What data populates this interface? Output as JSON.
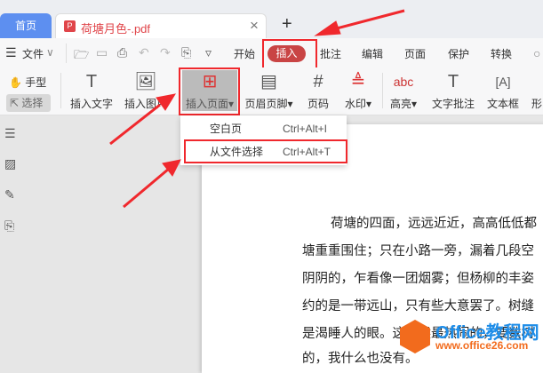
{
  "tabs": {
    "home": "首页",
    "document": "荷塘月色-.pdf",
    "pdf_icon": "P",
    "close": "×",
    "new_tab": "+"
  },
  "menu": {
    "hamburger": "☰",
    "file": "文件",
    "file_chevron": "∨",
    "more": "▿",
    "items": [
      "开始",
      "插入",
      "批注",
      "编辑",
      "页面",
      "保护",
      "转换"
    ]
  },
  "ribbon": {
    "hand": "手型",
    "select": "选择",
    "buttons": [
      "插入文字",
      "插入图片",
      "插入页面",
      "页眉页脚",
      "页码",
      "水印",
      "高亮",
      "文字批注",
      "文本框",
      "形"
    ]
  },
  "dropdown": {
    "items": [
      {
        "label": "空白页",
        "shortcut": "Ctrl+Alt+I"
      },
      {
        "label": "从文件选择",
        "shortcut": "Ctrl+Alt+T"
      }
    ]
  },
  "document": {
    "lines": [
      "荷塘的四面，远远近近，高高低低都",
      "塘重重围住；只在小路一旁，漏着几段空",
      "阴阴的，乍看像一团烟雾；但杨柳的丰姿",
      "约的是一带远山，只有些大意罢了。树缝",
      "是渴睡人的眼。这时候最热闹的，要数树",
      "的，我什么也没有。"
    ]
  },
  "watermark": {
    "title": "Office教程网",
    "url": "www.office26.com"
  },
  "colors": {
    "accent": "#c94444",
    "highlight": "#f0282d",
    "home_tab": "#5d8ff0"
  }
}
